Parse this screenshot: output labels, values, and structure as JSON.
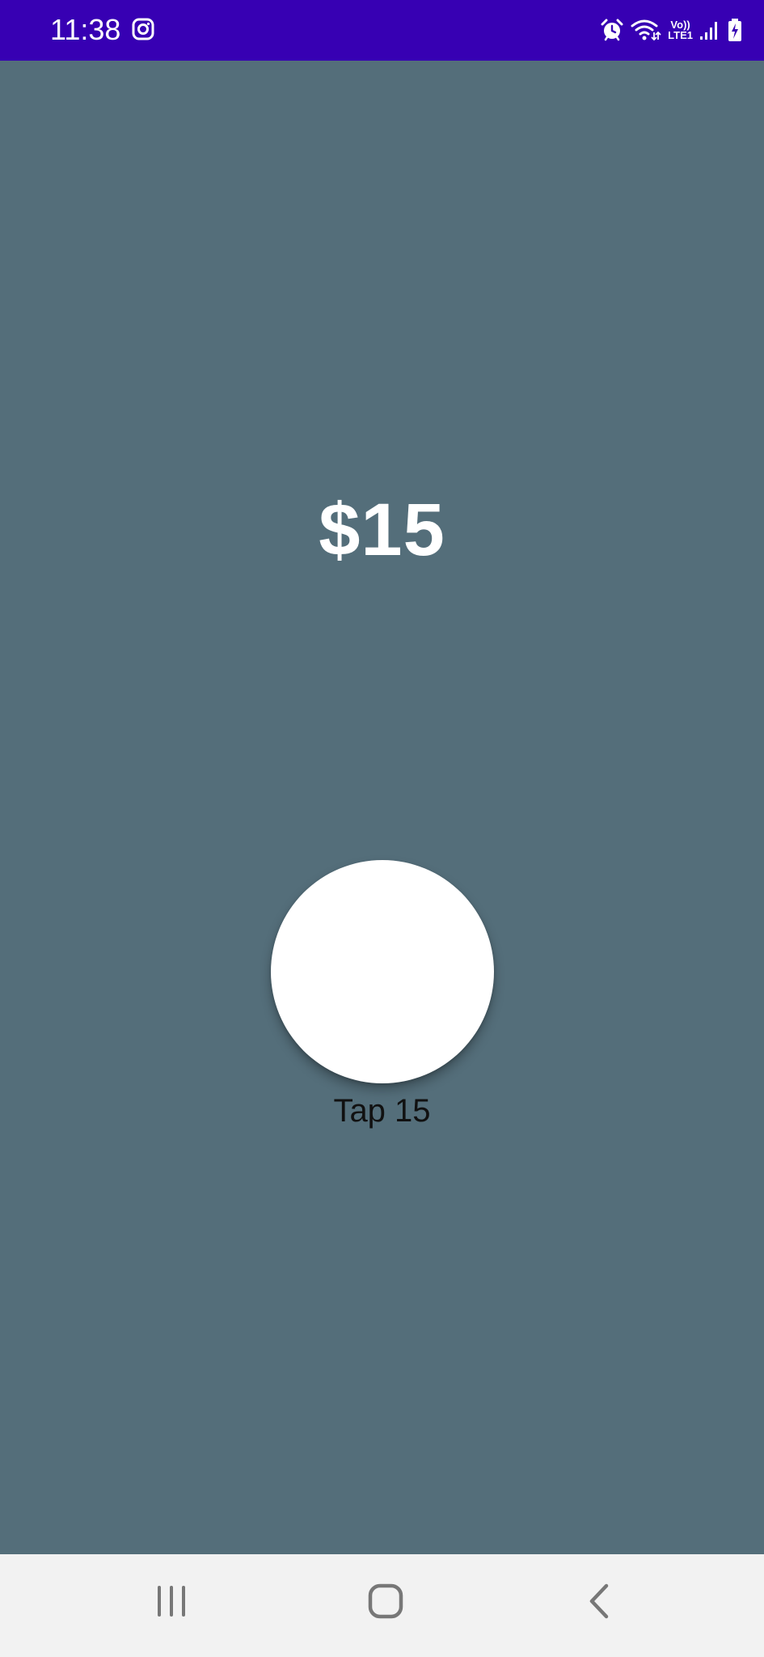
{
  "status_bar": {
    "time": "11:38",
    "app_icon": "instagram-icon",
    "volte_line1": "Vo))",
    "volte_line2": "LTE1",
    "icons": [
      "alarm-icon",
      "wifi-icon",
      "volte-icon",
      "signal-icon",
      "battery-charging-icon"
    ],
    "background_color": "#3700B3"
  },
  "main": {
    "amount": "$15",
    "tap_label": "Tap 15",
    "background_color": "#546E7A",
    "button_color": "#ffffff"
  },
  "nav_bar": {
    "buttons": [
      "recent-apps-icon",
      "home-icon",
      "back-icon"
    ],
    "background_color": "#f2f2f2"
  }
}
